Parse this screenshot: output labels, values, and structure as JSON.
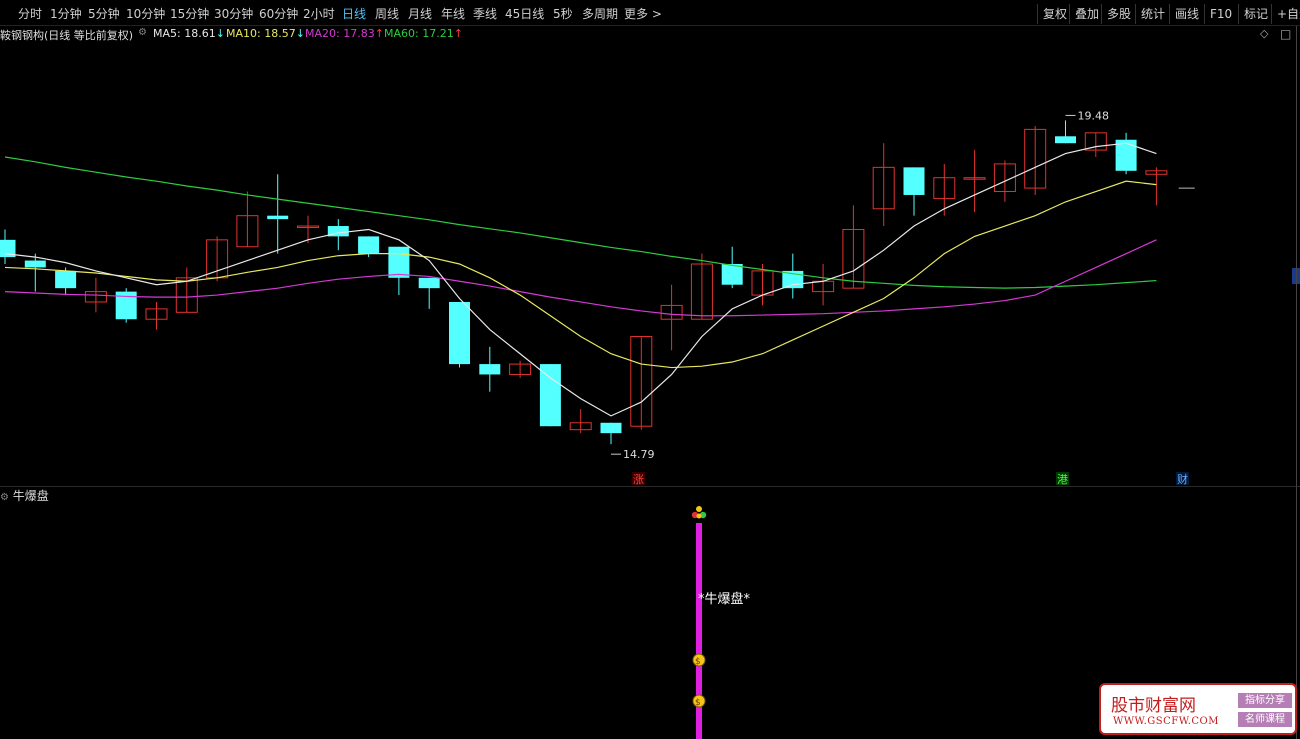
{
  "toolbar": {
    "periods": [
      "分时",
      "1分钟",
      "5分钟",
      "10分钟",
      "15分钟",
      "30分钟",
      "60分钟",
      "2小时",
      "日线",
      "周线",
      "月线",
      "年线",
      "季线",
      "45日线",
      "5秒",
      "多周期",
      "更多 >"
    ],
    "active_period": "日线",
    "right_buttons": [
      "复权",
      "叠加",
      "多股",
      "统计",
      "画线",
      "F10",
      "标记",
      "+自选"
    ]
  },
  "info": {
    "title": "鞍钢钢构(日线 等比前复权)",
    "ma5": "MA5: 18.61",
    "ma5_arrow": "↓",
    "ma10": "MA10: 18.57",
    "ma10_arrow": "↓",
    "ma20": "MA20: 17.83",
    "ma20_arrow": "↑",
    "ma60": "MA60: 17.21",
    "ma60_arrow": "↑",
    "diamond": "◇"
  },
  "colors": {
    "up": "#e0332e",
    "down": "#54ffff",
    "ma5": "#e8e8e8",
    "ma10": "#e8e860",
    "ma20": "#d43ad4",
    "ma60": "#2ecc40",
    "indicator_bar": "#e020e0"
  },
  "chart_data": {
    "type": "candlestick",
    "price_range": [
      14.3,
      20.5
    ],
    "high_marker": "19.48",
    "low_marker": "14.79",
    "candles": [
      {
        "o": 17.75,
        "c": 17.5,
        "h": 17.9,
        "l": 17.4
      },
      {
        "o": 17.45,
        "c": 17.35,
        "h": 17.55,
        "l": 17.0
      },
      {
        "o": 17.3,
        "c": 17.05,
        "h": 17.35,
        "l": 16.95
      },
      {
        "o": 16.85,
        "c": 17.0,
        "h": 17.2,
        "l": 16.7
      },
      {
        "o": 17.0,
        "c": 16.6,
        "h": 17.05,
        "l": 16.55
      },
      {
        "o": 16.6,
        "c": 16.75,
        "h": 16.85,
        "l": 16.45
      },
      {
        "o": 16.7,
        "c": 17.2,
        "h": 17.35,
        "l": 16.7
      },
      {
        "o": 17.2,
        "c": 17.75,
        "h": 17.8,
        "l": 17.15
      },
      {
        "o": 17.65,
        "c": 18.1,
        "h": 18.45,
        "l": 17.65
      },
      {
        "o": 18.1,
        "c": 18.05,
        "h": 18.7,
        "l": 17.55
      },
      {
        "o": 17.95,
        "c": 17.95,
        "h": 18.1,
        "l": 17.7
      },
      {
        "o": 17.95,
        "c": 17.8,
        "h": 18.05,
        "l": 17.6
      },
      {
        "o": 17.8,
        "c": 17.55,
        "h": 17.8,
        "l": 17.5
      },
      {
        "o": 17.65,
        "c": 17.2,
        "h": 17.65,
        "l": 16.95
      },
      {
        "o": 17.2,
        "c": 17.05,
        "h": 17.2,
        "l": 16.75
      },
      {
        "o": 16.85,
        "c": 15.95,
        "h": 16.85,
        "l": 15.9
      },
      {
        "o": 15.95,
        "c": 15.8,
        "h": 16.2,
        "l": 15.55
      },
      {
        "o": 15.8,
        "c": 15.95,
        "h": 16.0,
        "l": 15.75
      },
      {
        "o": 15.95,
        "c": 15.05,
        "h": 15.95,
        "l": 15.05
      },
      {
        "o": 15.0,
        "c": 15.1,
        "h": 15.3,
        "l": 14.95
      },
      {
        "o": 15.1,
        "c": 14.95,
        "h": 15.1,
        "l": 14.79
      },
      {
        "o": 15.05,
        "c": 16.35,
        "h": 16.35,
        "l": 15.0
      },
      {
        "o": 16.6,
        "c": 16.8,
        "h": 17.1,
        "l": 16.15
      },
      {
        "o": 16.6,
        "c": 17.4,
        "h": 17.55,
        "l": 16.6
      },
      {
        "o": 17.4,
        "c": 17.1,
        "h": 17.65,
        "l": 17.05
      },
      {
        "o": 16.95,
        "c": 17.3,
        "h": 17.4,
        "l": 16.8
      },
      {
        "o": 17.3,
        "c": 17.05,
        "h": 17.55,
        "l": 16.9
      },
      {
        "o": 17.0,
        "c": 17.15,
        "h": 17.4,
        "l": 16.8
      },
      {
        "o": 17.05,
        "c": 17.9,
        "h": 18.25,
        "l": 17.05
      },
      {
        "o": 18.2,
        "c": 18.8,
        "h": 19.15,
        "l": 17.95
      },
      {
        "o": 18.8,
        "c": 18.4,
        "h": 18.8,
        "l": 18.1
      },
      {
        "o": 18.35,
        "c": 18.65,
        "h": 18.85,
        "l": 18.1
      },
      {
        "o": 18.65,
        "c": 18.65,
        "h": 19.05,
        "l": 18.15
      },
      {
        "o": 18.45,
        "c": 18.85,
        "h": 18.9,
        "l": 18.3
      },
      {
        "o": 18.5,
        "c": 19.35,
        "h": 19.4,
        "l": 18.4
      },
      {
        "o": 19.25,
        "c": 19.15,
        "h": 19.48,
        "l": 19.15
      },
      {
        "o": 19.05,
        "c": 19.3,
        "h": 19.3,
        "l": 18.95
      },
      {
        "o": 19.2,
        "c": 18.75,
        "h": 19.3,
        "l": 18.7
      },
      {
        "o": 18.7,
        "c": 18.75,
        "h": 18.8,
        "l": 18.25
      }
    ],
    "last_price": 18.5,
    "ma5": [
      17.55,
      17.5,
      17.42,
      17.3,
      17.2,
      17.1,
      17.15,
      17.3,
      17.45,
      17.6,
      17.75,
      17.85,
      17.9,
      17.75,
      17.45,
      16.9,
      16.45,
      16.1,
      15.75,
      15.45,
      15.2,
      15.4,
      15.8,
      16.35,
      16.75,
      16.95,
      17.1,
      17.15,
      17.3,
      17.6,
      17.95,
      18.2,
      18.4,
      18.6,
      18.8,
      19.0,
      19.1,
      19.15,
      19.0
    ],
    "ma10": [
      17.35,
      17.33,
      17.3,
      17.27,
      17.22,
      17.17,
      17.15,
      17.2,
      17.28,
      17.35,
      17.45,
      17.52,
      17.55,
      17.55,
      17.5,
      17.4,
      17.2,
      16.95,
      16.65,
      16.35,
      16.1,
      15.95,
      15.9,
      15.92,
      15.98,
      16.1,
      16.3,
      16.5,
      16.7,
      16.9,
      17.2,
      17.55,
      17.8,
      17.95,
      18.1,
      18.3,
      18.45,
      18.6,
      18.55
    ],
    "ma20": [
      17.0,
      16.98,
      16.96,
      16.95,
      16.93,
      16.92,
      16.92,
      16.95,
      17.0,
      17.05,
      17.12,
      17.18,
      17.22,
      17.25,
      17.22,
      17.15,
      17.08,
      17.0,
      16.92,
      16.85,
      16.78,
      16.72,
      16.67,
      16.65,
      16.65,
      16.66,
      16.67,
      16.68,
      16.7,
      16.72,
      16.75,
      16.78,
      16.82,
      16.87,
      16.95,
      17.15,
      17.35,
      17.55,
      17.75
    ],
    "ma60": [
      18.95,
      18.88,
      18.8,
      18.73,
      18.66,
      18.6,
      18.53,
      18.47,
      18.4,
      18.34,
      18.28,
      18.22,
      18.16,
      18.1,
      18.04,
      17.97,
      17.91,
      17.85,
      17.78,
      17.71,
      17.64,
      17.58,
      17.51,
      17.45,
      17.38,
      17.32,
      17.26,
      17.2,
      17.15,
      17.12,
      17.09,
      17.07,
      17.06,
      17.05,
      17.06,
      17.08,
      17.1,
      17.13,
      17.16
    ],
    "markers": {
      "zhang": "涨",
      "gang": "港",
      "cai": "财"
    }
  },
  "sub": {
    "title": "牛爆盘",
    "label": "*牛爆盘*"
  },
  "watermark": {
    "title": "股市财富网",
    "url": "WWW.GSCFW.COM",
    "tag1": "指标分享",
    "tag2": "名师课程"
  }
}
